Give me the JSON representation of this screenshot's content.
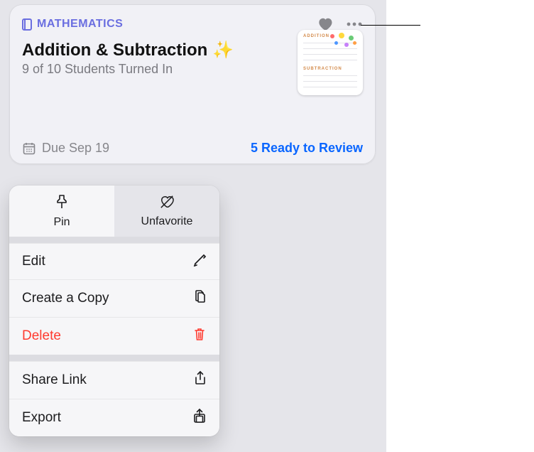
{
  "card": {
    "class_label": "MATHEMATICS",
    "title": "Addition & Subtraction ✨",
    "subtitle": "9 of 10 Students Turned In",
    "due_label": "Due Sep 19",
    "review_label": "5 Ready to Review",
    "thumb": {
      "h1": "ADDITION",
      "h2": "SUBTRACTION"
    }
  },
  "menu": {
    "tabs": {
      "pin": "Pin",
      "unfavorite": "Unfavorite"
    },
    "items": {
      "edit": "Edit",
      "copy": "Create a Copy",
      "delete": "Delete",
      "share": "Share Link",
      "export": "Export"
    }
  }
}
